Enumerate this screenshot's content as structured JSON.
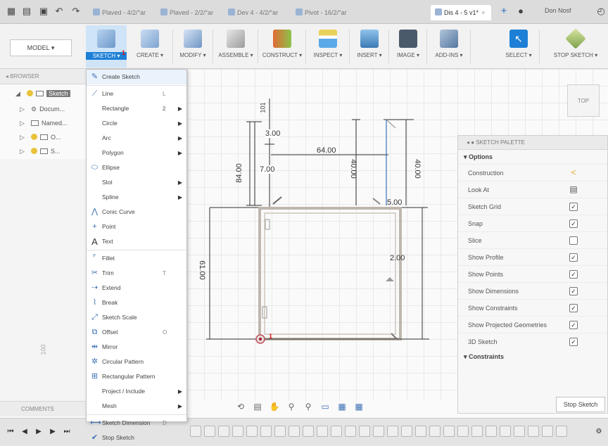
{
  "colors": {
    "accent": "#1d7fd6",
    "sketch_line": "#bfb7ae",
    "dim_line": "#333333",
    "warning": "#e8a325",
    "badge": "#dd1111"
  },
  "tabbar": {
    "tabs": [
      {
        "label": "Plaved - 4/2/°ar"
      },
      {
        "label": "Plaved - 2/2/°ar"
      },
      {
        "label": "Dev 4 - 4/2/°ar"
      },
      {
        "label": "Pivot - 16/2/°ar"
      },
      {
        "label": "Dis 4 - 5 v1*"
      }
    ],
    "user": "Don Nosf"
  },
  "ribbon": {
    "workspace": "MODEL ▾",
    "groups": [
      {
        "label": "SKETCH ▾",
        "icon": "sketch-icon"
      },
      {
        "label": "CREATE ▾",
        "icon": "create-icon"
      },
      {
        "label": "MODIFY ▾",
        "icon": "modify-icon"
      },
      {
        "label": "ASSEMBLE ▾",
        "icon": "assemble-icon"
      },
      {
        "label": "CONSTRUCT ▾",
        "icon": "construct-icon"
      },
      {
        "label": "INSPECT ▾",
        "icon": "inspect-icon"
      },
      {
        "label": "INSERT ▾",
        "icon": "insert-icon"
      },
      {
        "label": "IMAGE ▾",
        "icon": "image-icon"
      },
      {
        "label": "ADD-INS ▾",
        "icon": "addins-icon"
      },
      {
        "label": "SELECT ▾",
        "icon": "select-icon"
      },
      {
        "label": "STOP SKETCH ▾",
        "icon": "stop-sketch-icon"
      }
    ],
    "sketch_badge": "1"
  },
  "browser": {
    "header": "◂ BROWSER",
    "rows": [
      {
        "label": "Sketch"
      },
      {
        "label": "Docum..."
      },
      {
        "label": "Named..."
      },
      {
        "label": "O..."
      },
      {
        "label": "S..."
      }
    ]
  },
  "sketch_menu": {
    "items": [
      {
        "label": "Create Sketch",
        "icon": "create-sketch-icon",
        "glyph": "✎",
        "shortcut": "",
        "sub": false,
        "sep_after": true
      },
      {
        "label": "Line",
        "icon": "line-icon",
        "glyph": "⟋",
        "shortcut": "L",
        "sub": false
      },
      {
        "label": "Rectangle",
        "icon": "rectangle-icon",
        "glyph": "",
        "shortcut": "2",
        "sub": true
      },
      {
        "label": "Circle",
        "icon": "circle-icon",
        "glyph": "",
        "shortcut": "",
        "sub": true
      },
      {
        "label": "Arc",
        "icon": "arc-icon",
        "glyph": "",
        "shortcut": "",
        "sub": true
      },
      {
        "label": "Polygon",
        "icon": "polygon-icon",
        "glyph": "",
        "shortcut": "",
        "sub": true
      },
      {
        "label": "Ellipse",
        "icon": "ellipse-icon",
        "glyph": "⬭",
        "shortcut": "",
        "sub": false
      },
      {
        "label": "Slot",
        "icon": "slot-icon",
        "glyph": "",
        "shortcut": "",
        "sub": true
      },
      {
        "label": "Spline",
        "icon": "spline-icon",
        "glyph": "",
        "shortcut": "",
        "sub": true
      },
      {
        "label": "Conic Curve",
        "icon": "conic-curve-icon",
        "glyph": "⋀",
        "shortcut": "",
        "sub": false
      },
      {
        "label": "Point",
        "icon": "point-icon",
        "glyph": "+",
        "shortcut": "",
        "sub": false
      },
      {
        "label": "Text",
        "icon": "text-icon",
        "glyph": "A",
        "shortcut": "",
        "sub": false,
        "sep_after": true
      },
      {
        "label": "Fillet",
        "icon": "fillet-icon",
        "glyph": "⌜",
        "shortcut": "",
        "sub": false
      },
      {
        "label": "Trim",
        "icon": "trim-icon",
        "glyph": "✂",
        "shortcut": "T",
        "sub": false
      },
      {
        "label": "Extend",
        "icon": "extend-icon",
        "glyph": "⇢",
        "shortcut": "",
        "sub": false
      },
      {
        "label": "Break",
        "icon": "break-icon",
        "glyph": "⌇",
        "shortcut": "",
        "sub": false
      },
      {
        "label": "Sketch Scale",
        "icon": "sketch-scale-icon",
        "glyph": "⤢",
        "shortcut": "",
        "sub": false
      },
      {
        "label": "Offset",
        "icon": "offset-icon",
        "glyph": "⧉",
        "shortcut": "O",
        "sub": false
      },
      {
        "label": "Mirror",
        "icon": "mirror-icon",
        "glyph": "⇹",
        "shortcut": "",
        "sub": false
      },
      {
        "label": "Circular Pattern",
        "icon": "circular-pattern-icon",
        "glyph": "✲",
        "shortcut": "",
        "sub": false
      },
      {
        "label": "Rectangular Pattern",
        "icon": "rectangular-pattern-icon",
        "glyph": "⊞",
        "shortcut": "",
        "sub": false
      },
      {
        "label": "Project / Include",
        "icon": "project-include-icon",
        "glyph": "",
        "shortcut": "",
        "sub": true
      },
      {
        "label": "Mesh",
        "icon": "mesh-icon",
        "glyph": "",
        "shortcut": "",
        "sub": true,
        "sep_after": true
      },
      {
        "label": "Sketch Dimension",
        "icon": "sketch-dimension-icon",
        "glyph": "⟷",
        "shortcut": "D",
        "sub": false
      },
      {
        "label": "Stop Sketch",
        "icon": "stop-sketch-menu-icon",
        "glyph": "✔",
        "shortcut": "",
        "sub": false
      }
    ]
  },
  "sketch": {
    "dims": {
      "d_101": "101",
      "d_3": "3.00",
      "d_84a": "84.00",
      "d_7": "7.00",
      "d_64": "64.00",
      "d_40a": "40.00",
      "d_40b": "40.00",
      "d_5": "5.00",
      "d_2": "2.00",
      "d_61": "61.00",
      "d_side": "100"
    },
    "origin_badge": "1"
  },
  "viewcube": "TOP",
  "palette": {
    "header": "◂ ● SKETCH PALETTE",
    "options_header": "▾ Options",
    "constraints_header": "▾ Constraints",
    "rows": [
      {
        "label": "Construction",
        "type": "icon",
        "value": "<"
      },
      {
        "label": "Look At",
        "type": "icon",
        "value": "▤"
      },
      {
        "label": "Sketch Grid",
        "type": "check",
        "value": "✓"
      },
      {
        "label": "Snap",
        "type": "check",
        "value": "✓"
      },
      {
        "label": "Slice",
        "type": "check",
        "value": ""
      },
      {
        "label": "Show Profile",
        "type": "check",
        "value": "✓"
      },
      {
        "label": "Show Points",
        "type": "check",
        "value": "✓"
      },
      {
        "label": "Show Dimensions",
        "type": "check",
        "value": "✓"
      },
      {
        "label": "Show Constraints",
        "type": "check",
        "value": "✓"
      },
      {
        "label": "Show Projected Geometries",
        "type": "check",
        "value": "✓"
      },
      {
        "label": "3D Sketch",
        "type": "check",
        "value": "✓"
      }
    ],
    "stop_button": "Stop Sketch"
  },
  "comments": "COMMENTS",
  "navbar": {
    "icons": [
      "orbit-icon",
      "look-at-icon",
      "pan-icon",
      "zoom-icon",
      "fit-icon",
      "display-icon",
      "grid-icon",
      "viewports-icon"
    ]
  }
}
